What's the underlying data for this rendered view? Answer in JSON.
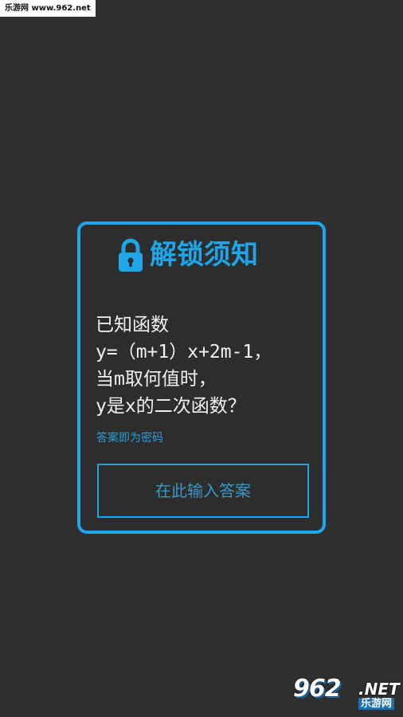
{
  "source_tag": "乐游网 www.962.net",
  "dialog": {
    "title": "解锁须知",
    "lock_icon": "lock-icon",
    "question_lines": [
      "已知函数",
      "y=（m+1）x+2m-1，",
      "当m取何值时，",
      "y是x的二次函数？"
    ],
    "hint": "答案即为密码",
    "answer_input": {
      "value": "",
      "placeholder": "在此输入答案"
    }
  },
  "watermark": {
    "number": "962",
    "suffix": ".NET",
    "name": "乐游网"
  },
  "colors": {
    "background": "#2f2f2f",
    "accent": "#1ea6e8",
    "text": "#f2f2f2",
    "hint": "#2a9fd8"
  }
}
